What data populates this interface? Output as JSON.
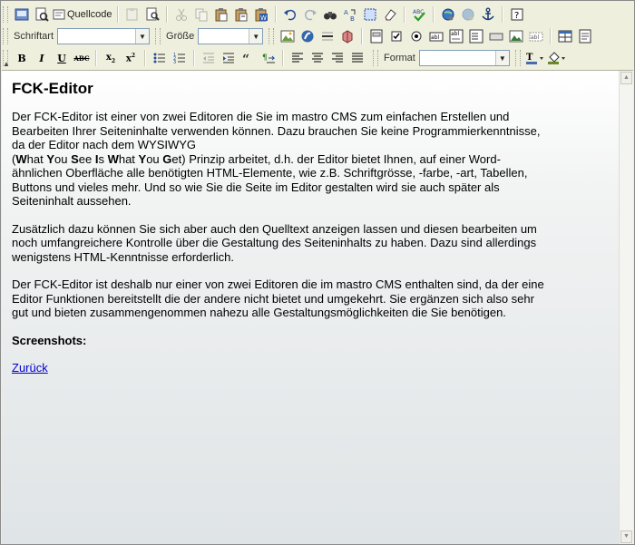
{
  "toolbar": {
    "source_label": "Quellcode",
    "font_label": "Schriftart",
    "font_value": "",
    "size_label": "Größe",
    "size_value": "",
    "format_label": "Format",
    "format_value": ""
  },
  "content": {
    "title": "FCK-Editor",
    "p1": {
      "part1": "Der FCK-Editor ist einer von zwei Editoren die Sie im mastro CMS zum einfachen Erstellen und Bearbeiten Ihrer Seiteninhalte verwenden können. Dazu brauchen Sie keine Programmierkenntnisse, da der Editor nach dem WYSIWYG",
      "acronym_open": "(",
      "w1": "W",
      "w1r": "hat ",
      "w2": "Y",
      "w2r": "ou ",
      "w3": "S",
      "w3r": "ee ",
      "w4": "I",
      "w4r": "s ",
      "w5": "W",
      "w5r": "hat ",
      "w6": "Y",
      "w6r": "ou ",
      "w7": "G",
      "w7r": "et)",
      "part2": " Prinzip arbeitet, d.h. der Editor bietet Ihnen, auf einer Word-ähnlichen Oberfläche alle benötigten HTML-Elemente, wie z.B. Schriftgrösse, -farbe, -art, Tabellen, Buttons und vieles mehr. Und so wie Sie die Seite im Editor gestalten wird sie auch später als Seiteninhalt aussehen."
    },
    "p2": "Zusätzlich dazu können Sie sich aber auch den Quelltext anzeigen lassen und diesen bearbeiten um noch umfangreichere Kontrolle über die Gestaltung des Seiteninhalts zu haben. Dazu sind allerdings wenigstens HTML-Kenntnisse erforderlich.",
    "p3": "Der FCK-Editor ist deshalb nur einer von zwei Editoren die im mastro CMS enthalten sind, da der eine Editor Funktionen bereitstellt die der andere nicht bietet und umgekehrt. Sie ergänzen sich also sehr gut und bieten zusammengenommen nahezu alle Gestaltungsmöglichkeiten die Sie benötigen.",
    "screenshots_label": "Screenshots:",
    "back_link": "Zurück"
  },
  "icons": [
    "save-icon",
    "preview-icon",
    "source-icon",
    "paste-icon",
    "print-icon",
    "cut-icon",
    "copy-icon",
    "paste-text-icon",
    "paste-word-icon",
    "undo-icon",
    "redo-icon",
    "find-icon",
    "replace-icon",
    "select-all-icon",
    "remove-format-icon",
    "spellcheck-icon",
    "link-icon",
    "unlink-icon",
    "anchor-icon",
    "about-icon"
  ],
  "colors": {
    "toolbar_bg": "#efefde",
    "link": "#0000cc"
  }
}
